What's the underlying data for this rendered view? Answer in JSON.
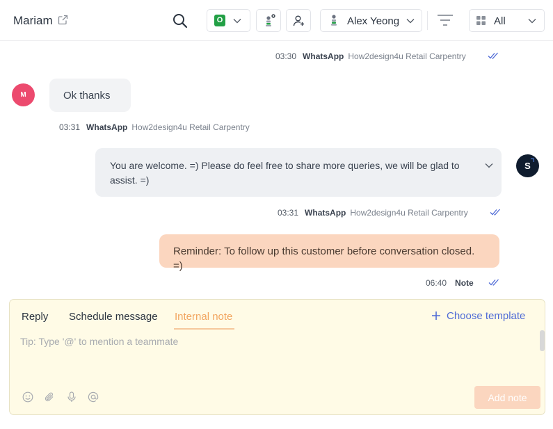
{
  "header": {
    "contact_name": "Mariam",
    "status_badge": "O",
    "assignee_name": "Alex Yeong",
    "filter_label": "All"
  },
  "messages": [
    {
      "time": "03:30",
      "channel": "WhatsApp",
      "account": "How2design4u Retail Carpentry"
    },
    {
      "avatar": "M",
      "text": "Ok thanks",
      "time": "03:31",
      "channel": "WhatsApp",
      "account": "How2design4u Retail Carpentry"
    },
    {
      "avatar": "S",
      "text": "You are welcome. =) Please do feel free to share more queries, we will be glad to assist. =)",
      "time": "03:31",
      "channel": "WhatsApp",
      "account": "How2design4u Retail Carpentry"
    },
    {
      "text": "Reminder: To follow up this customer before conversation closed. =)",
      "time": "06:40",
      "channel": "Note"
    }
  ],
  "composer": {
    "tabs": [
      "Reply",
      "Schedule message",
      "Internal note"
    ],
    "template_label": "Choose template",
    "placeholder": "Tip: Type '@' to mention a teammate",
    "add_note_label": "Add note"
  },
  "colors": {
    "accent": "#4f6bd6",
    "note_bg": "#fbd6bf",
    "internal_tab": "#f2a55f",
    "status_green": "#22a045",
    "avatar_m": "#ec4a6e",
    "avatar_s": "#0f1c2e",
    "composer_bg": "#fffbe6"
  }
}
